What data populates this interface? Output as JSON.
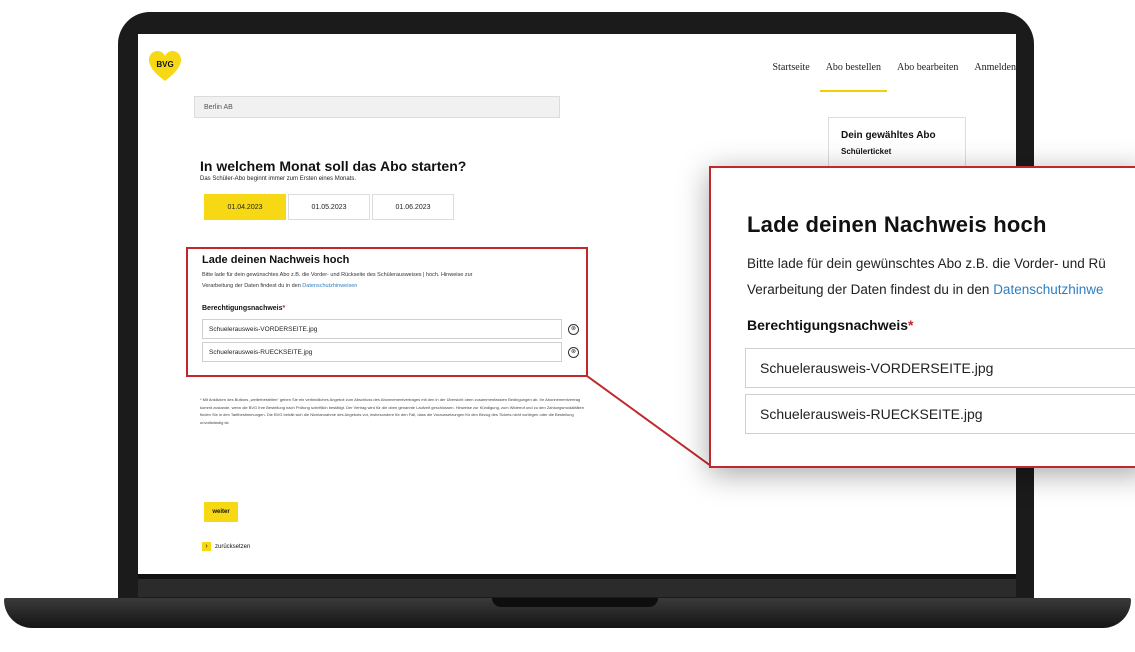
{
  "header": {
    "logo_text": "BVG",
    "nav": [
      {
        "label": "Startseite"
      },
      {
        "label": "Abo bestellen",
        "active": true
      },
      {
        "label": "Abo bearbeiten"
      },
      {
        "label": "Anmelden"
      }
    ]
  },
  "address_field": {
    "value": "Berlin AB"
  },
  "month_section": {
    "title": "In welchem Monat soll das Abo starten?",
    "subtitle": "Das Schüler-Abo beginnt immer zum Ersten eines Monats.",
    "options": [
      {
        "label": "01.04.2023",
        "selected": true
      },
      {
        "label": "01.05.2023"
      },
      {
        "label": "01.06.2023"
      }
    ]
  },
  "abo_card": {
    "title": "Dein gewähltes Abo",
    "subtitle": "Schülerticket"
  },
  "upload": {
    "title": "Lade deinen Nachweis hoch",
    "text_line1": "Bitte lade für dein gewünschtes Abo z.B. die Vorder- und Rückseite des Schülerausweises | hoch. Hinweise zur",
    "text_line2": "Verarbeitung der Daten findest du in den",
    "link": "Datenschutzhinweisen",
    "label": "Berechtigungsnachweis",
    "required": "*",
    "files": [
      {
        "name": "Schuelerausweis-VORDERSEITE.jpg"
      },
      {
        "name": "Schuelerausweis-RUECKSEITE.jpg"
      }
    ],
    "remove_icon": "⊗"
  },
  "footnote": "* Mit Anklicken des Buttons „weiterbestellen“ geben Sie ein verbindliches Angebot zum Abschluss des Abonnementvertrages mit den in der Übersicht oben zusammenfassten Bedingungen ab. Ihr Abonnementvertrag kommt zustande, wenn die BVG Ihre Bestellung nach Prüfung schriftlich bestätigt. Der Vertrag wird für die oben genannte Laufzeit geschlossen. Hinweise zur Kündigung, zum Widerruf und zu den Zahlungsmodalitäten finden Sie in den Tarifbestimmungen. Die BVG behält sich die Nichtannahme des Angebots vor, insbesondere für den Fall, dass die Voraussetzungen für den Bezug des Tickets nicht vorliegen oder die Bestellung unvollständig ist.",
  "buttons": {
    "weiter": "weiter",
    "back": "zurücksetzen",
    "back_icon": "›"
  },
  "zoom": {
    "title": "Lade deinen Nachweis hoch",
    "text_line1": "Bitte lade für dein gewünschtes Abo z.B. die Vorder- und Rü",
    "text_line2": "Verarbeitung der Daten findest du in den",
    "link": "Datenschutzhinwe",
    "label": "Berechtigungsnachweis",
    "required": "*",
    "file1": "Schuelerausweis-VORDERSEITE.jpg",
    "file2": "Schuelerausweis-RUECKSEITE.jpg"
  },
  "colors": {
    "accent_yellow": "#f6d914",
    "highlight_red": "#c0282d",
    "link_blue": "#2f7fc1"
  }
}
